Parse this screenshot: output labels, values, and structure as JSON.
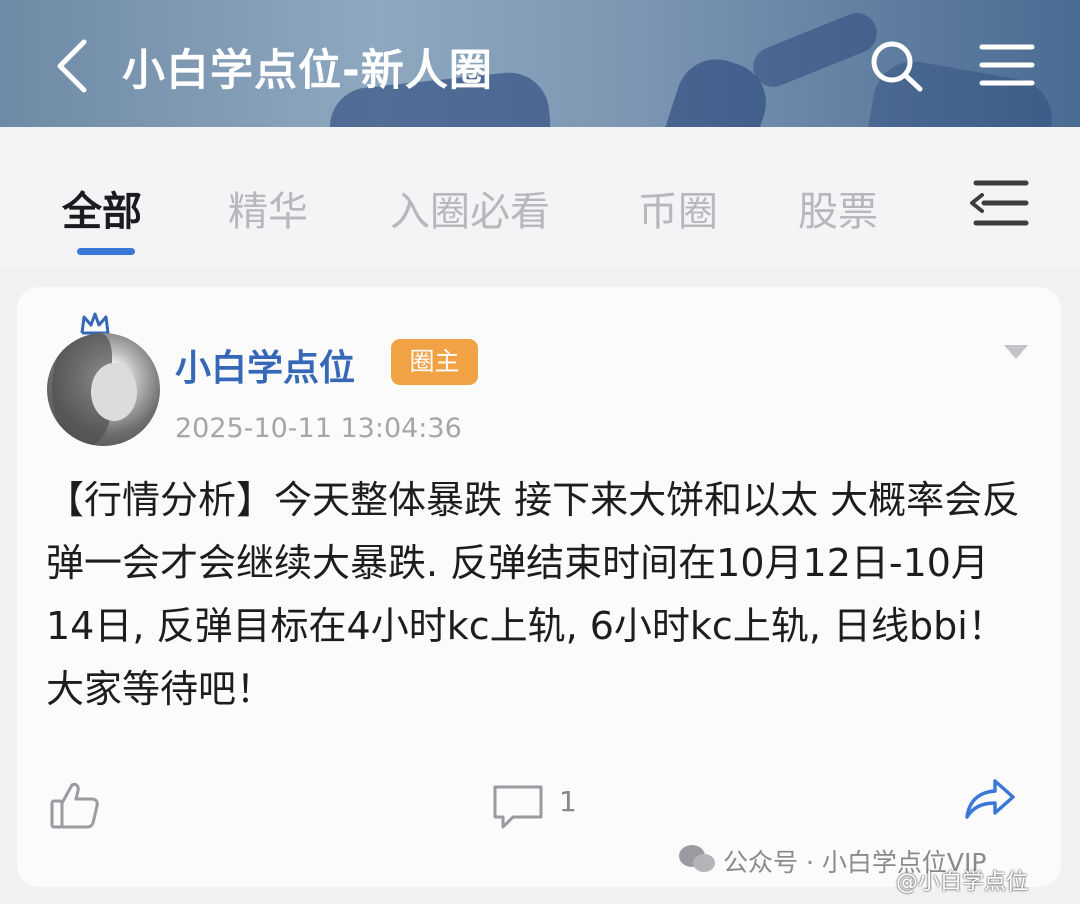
{
  "header": {
    "title": "小白学点位-新人圈",
    "back_icon": "chevron-left-icon",
    "search_icon": "search-icon",
    "menu_icon": "hamburger-menu-icon"
  },
  "tabs": [
    {
      "label": "全部",
      "active": true
    },
    {
      "label": "精华",
      "active": false
    },
    {
      "label": "入圈必看",
      "active": false
    },
    {
      "label": "币圈",
      "active": false
    },
    {
      "label": "股票",
      "active": false
    }
  ],
  "tabs_menu_icon": "list-menu-icon",
  "post": {
    "author": "小白学点位",
    "badge": "圈主",
    "timestamp": "2025-10-11 13:04:36",
    "content": "【行情分析】今天整体暴跌 接下来大饼和以太 大概率会反弹一会才会继续大暴跌. 反弹结束时间在10月12日-10月14日, 反弹目标在4小时kc上轨, 6小时kc上轨, 日线bbi！ 大家等待吧！",
    "comment_count": "1"
  },
  "watermark": {
    "text": "公众号 · 小白学点位VIP",
    "text2": "@小白学点位"
  },
  "colors": {
    "accent": "#3a78d8",
    "author": "#3668b7",
    "badge": "#f0a244"
  }
}
